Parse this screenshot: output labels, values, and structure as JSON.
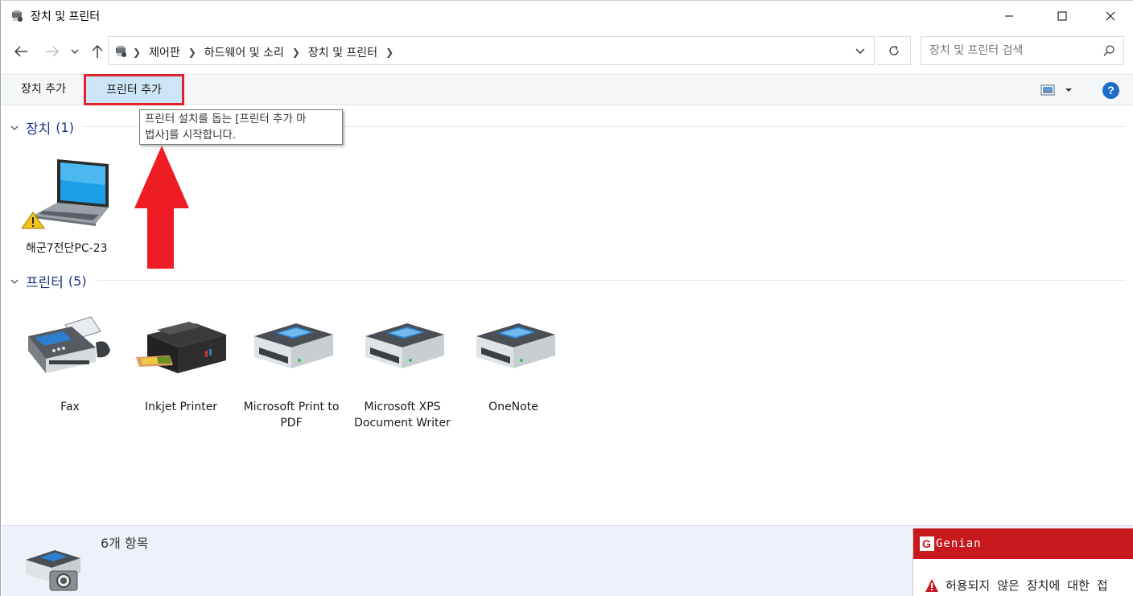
{
  "window": {
    "title": "장치 및 프린터"
  },
  "nav": {
    "breadcrumbs": [
      "제어판",
      "하드웨어 및 소리",
      "장치 및 프린터"
    ],
    "search_placeholder": "장치 및 프린터 검색"
  },
  "toolbar": {
    "add_device_label": "장치 추가",
    "add_printer_label": "프린터 추가",
    "help_label": "?"
  },
  "tooltip": {
    "line1": "프린터 설치를 돕는 [프린터 추가 마",
    "line2": "법사]를 시작합니다."
  },
  "groups": {
    "devices": {
      "title": "장치",
      "count": "(1)",
      "items": [
        {
          "label": "해군7전단PC-23",
          "icon": "laptop-warning-icon"
        }
      ]
    },
    "printers": {
      "title": "프린터",
      "count": "(5)",
      "items": [
        {
          "label": "Fax",
          "icon": "fax-icon"
        },
        {
          "label": "Inkjet Printer",
          "icon": "inkjet-printer-icon"
        },
        {
          "label": "Microsoft Print to PDF",
          "icon": "printer-icon"
        },
        {
          "label": "Microsoft XPS Document Writer",
          "icon": "printer-icon"
        },
        {
          "label": "OneNote",
          "icon": "printer-icon"
        }
      ]
    }
  },
  "details": {
    "count_label": "6개 항목"
  },
  "genian": {
    "brand": "Genian",
    "message": "허용되지 않은 장치에 대한 접"
  },
  "colors": {
    "accent_red": "#e0202a",
    "selected_bg": "#cde6f7",
    "group_title": "#1e3287",
    "genian_red": "#c7191e"
  }
}
